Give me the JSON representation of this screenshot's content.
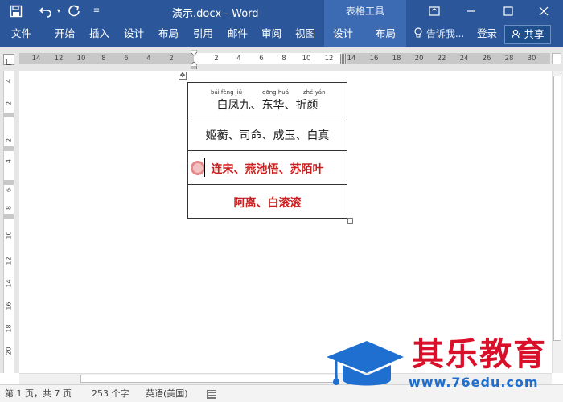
{
  "titlebar": {
    "save_icon": "save-icon",
    "undo_icon": "undo-icon",
    "redo_icon": "redo-icon",
    "customize_icon": "customize-qat-icon",
    "title": "演示.docx - Word",
    "contextual_tools": "表格工具",
    "window_buttons": [
      "restore-ribbon-icon",
      "minimize-icon",
      "maximize-icon",
      "close-icon"
    ]
  },
  "ribbon": {
    "tabs": [
      {
        "label": "文件"
      },
      {
        "label": "开始"
      },
      {
        "label": "插入"
      },
      {
        "label": "设计"
      },
      {
        "label": "布局"
      },
      {
        "label": "引用"
      },
      {
        "label": "邮件"
      },
      {
        "label": "审阅"
      },
      {
        "label": "视图"
      }
    ],
    "context_tabs": [
      {
        "label": "设计"
      },
      {
        "label": "布局"
      }
    ],
    "tell_me": "告诉我...",
    "login": "登录",
    "share": "共享"
  },
  "ruler": {
    "numbers_left": [
      "14",
      "12",
      "10",
      "8",
      "6",
      "4",
      "2"
    ],
    "numbers_right": [
      "2",
      "4",
      "6",
      "8",
      "10",
      "12",
      "14",
      "16",
      "18",
      "20",
      "22",
      "24",
      "26",
      "28",
      "30"
    ],
    "vertical_numbers": [
      "4",
      "2",
      "2",
      "4",
      "6",
      "8",
      "10",
      "12",
      "14",
      "16",
      "18",
      "20"
    ]
  },
  "table": {
    "rows": [
      {
        "text": "白凤九、东华、折颜",
        "style": "normal",
        "pinyin": [
          "bái fèng jiǔ",
          "dōng huá",
          "zhé yán"
        ]
      },
      {
        "text": "姬蘅、司命、成玉、白真",
        "style": "normal"
      },
      {
        "text": "连宋、燕池悟、苏陌叶",
        "style": "red"
      },
      {
        "text": "阿离、白滚滚",
        "style": "red"
      }
    ]
  },
  "statusbar": {
    "page": "第 1 页，共 7 页",
    "words": "253 个字",
    "language": "英语(美国)",
    "proofing_icon": "proofing-icon"
  },
  "watermark": {
    "brand": "其乐教育",
    "url": "www.76edu.com",
    "logo_icon": "graduation-cap-icon"
  },
  "colors": {
    "ribbon_blue": "#2b579a",
    "context_blue": "#3d6bb3",
    "highlight_red": "#cc1f1f",
    "watermark_red": "#d8102a",
    "watermark_blue": "#1e6fd0"
  }
}
